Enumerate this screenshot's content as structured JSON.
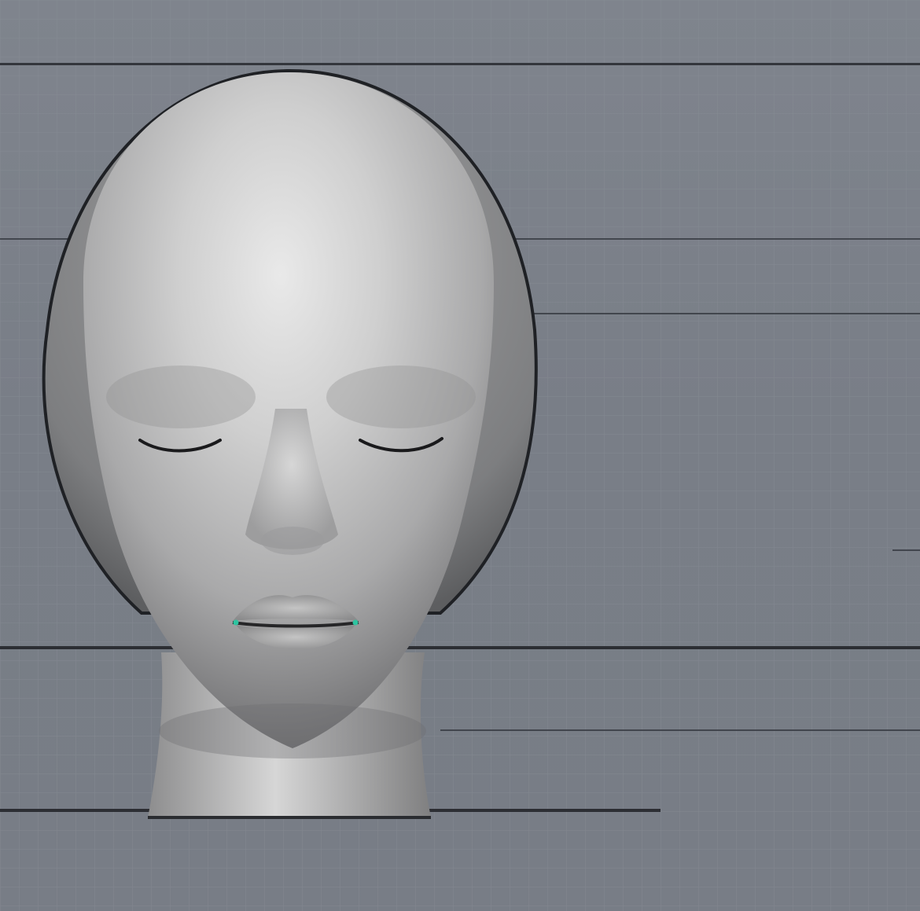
{
  "viewport": {
    "view": "front",
    "shading": "matcap-gray",
    "background_color": "#7b8089",
    "grid_color": "#8a8f98",
    "guide_line_color": "#2b2e33",
    "model_base_color": "#bdbdbd",
    "model_highlight_color": "#e6e6e6",
    "model_shadow_color": "#6e6e70",
    "lip_accent_color": "#2ec4a0"
  },
  "model": {
    "subject": "head-bust",
    "eyes": "closed",
    "mouth": "slightly-open"
  }
}
